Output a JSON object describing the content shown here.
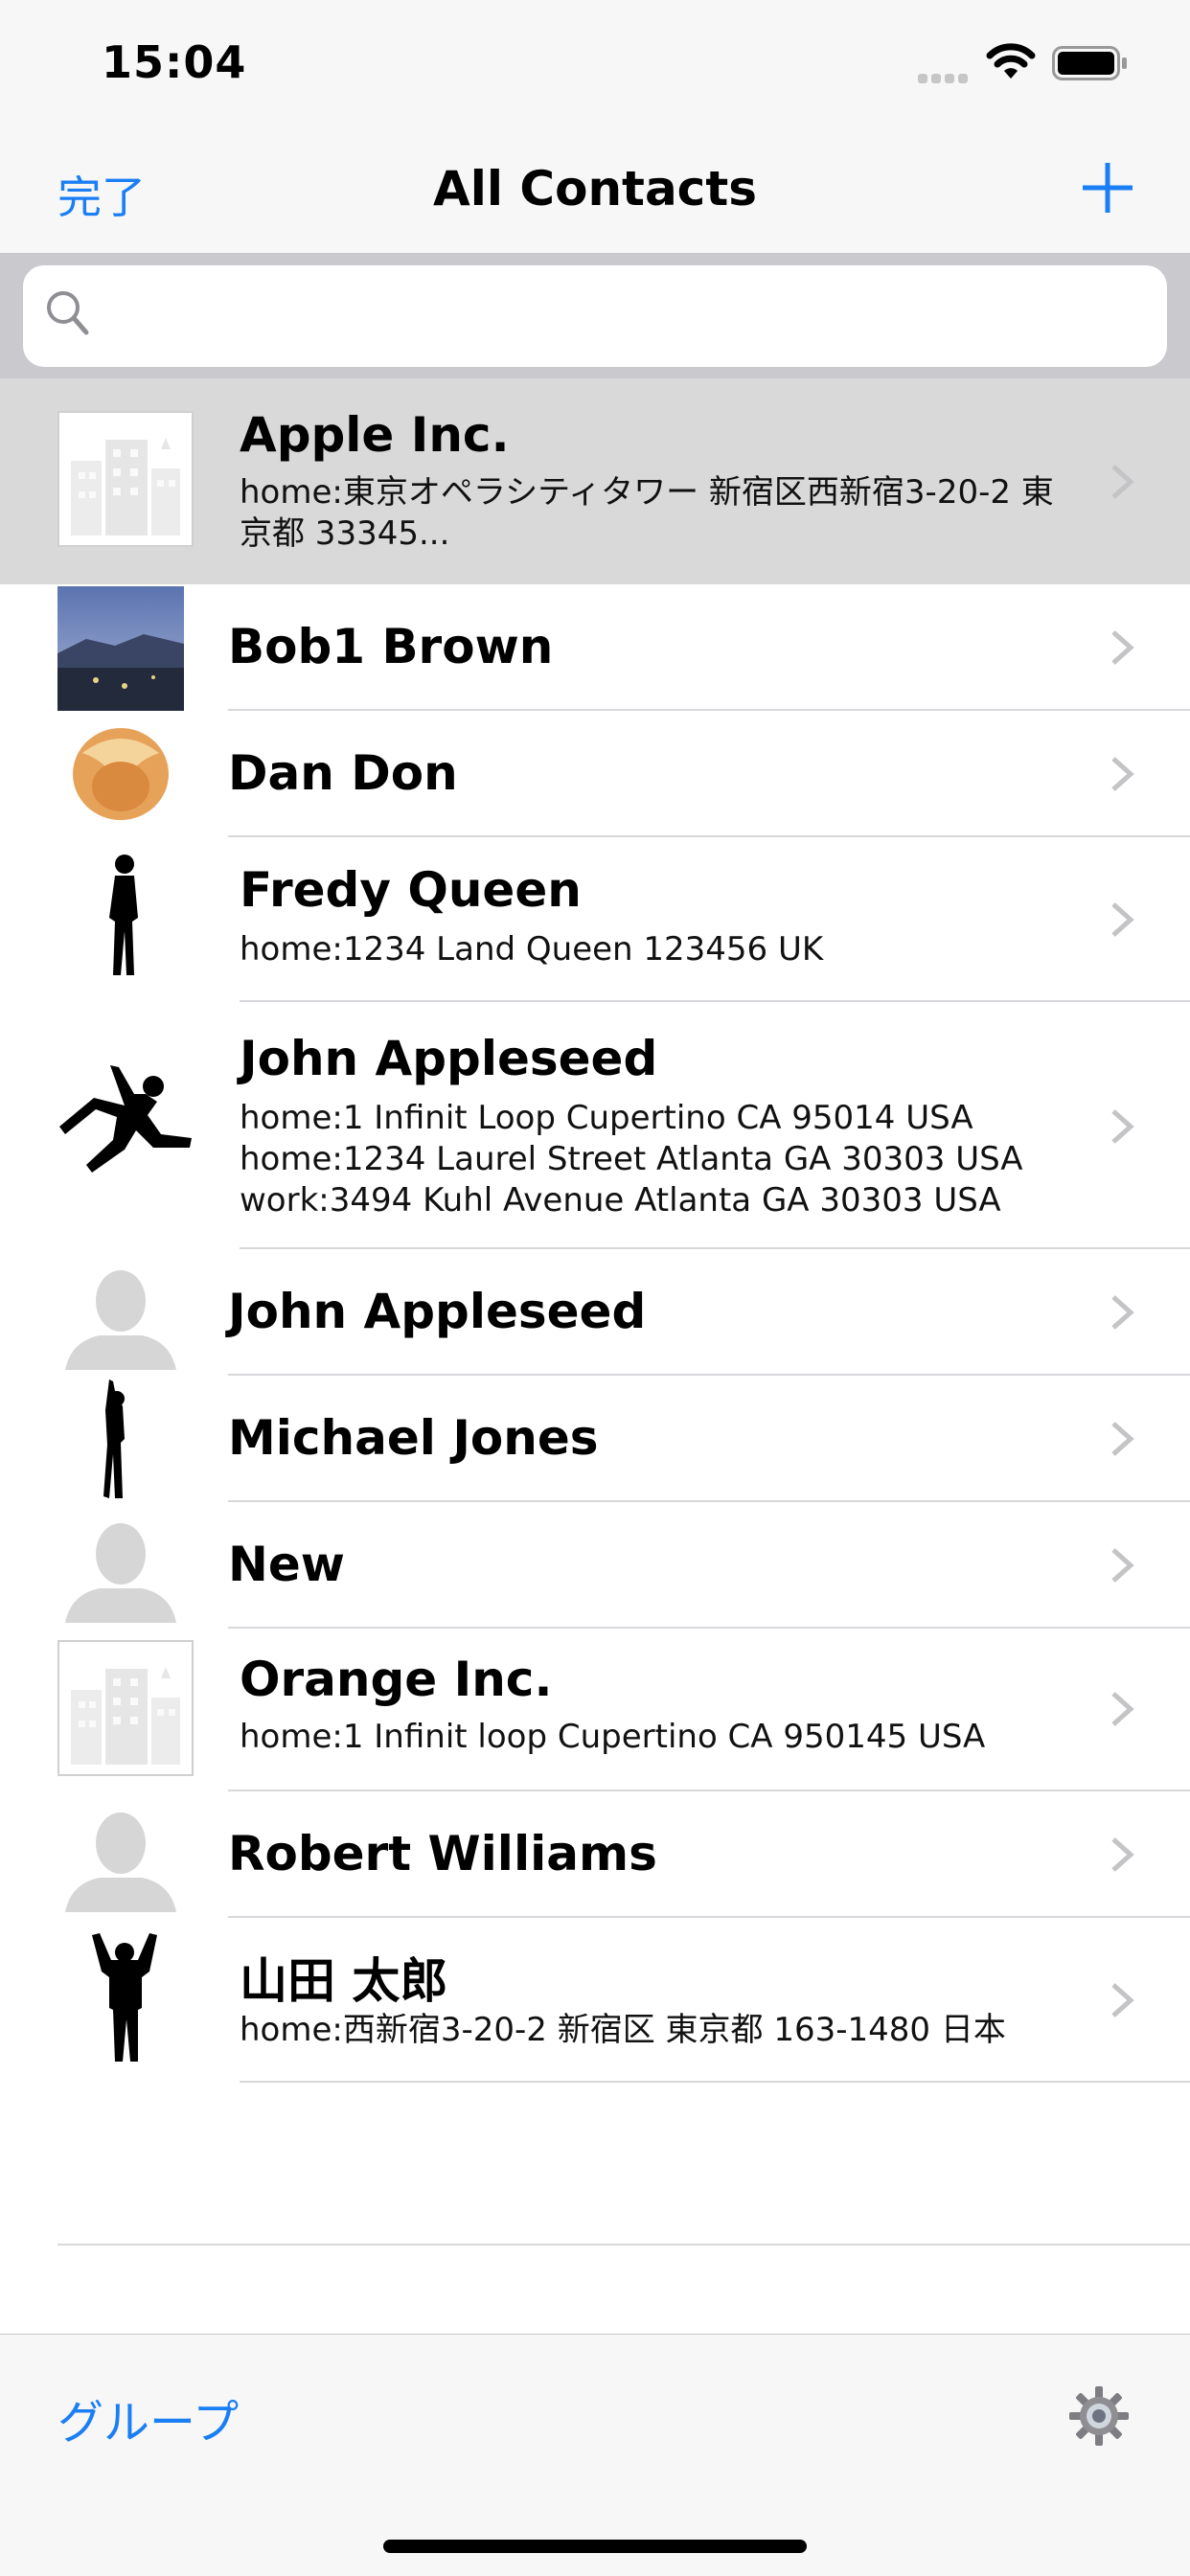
{
  "status": {
    "time": "15:04"
  },
  "nav": {
    "done": "完了",
    "title": "All Contacts",
    "add_icon": "plus-icon"
  },
  "search": {
    "placeholder": ""
  },
  "contacts": [
    {
      "name": "Apple Inc.",
      "address": "home:東京オペラシティタワー 新宿区西新宿3-20-2 東\n京都 33345...",
      "avatar": "building-icon"
    },
    {
      "name": "Bob1 Brown",
      "address": "",
      "avatar": "photo-landscape"
    },
    {
      "name": "Dan Don",
      "address": "",
      "avatar": "fortune-cookie"
    },
    {
      "name": "Fredy Queen",
      "address": "home:1234 Land Queen 123456 UK",
      "avatar": "silhouette-standing"
    },
    {
      "name": "John Appleseed",
      "address": "home:1 Infinit Loop Cupertino CA 95014 USA\nhome:1234 Laurel Street Atlanta GA 30303 USA\nwork:3494 Kuhl Avenue Atlanta GA 30303 USA",
      "avatar": "silhouette-jumping"
    },
    {
      "name": "John Appleseed",
      "address": "",
      "avatar": "default-person"
    },
    {
      "name": "Michael Jones",
      "address": "",
      "avatar": "silhouette-waving"
    },
    {
      "name": "New",
      "address": "",
      "avatar": "default-person"
    },
    {
      "name": "Orange Inc.",
      "address": "home:1 Infinit loop Cupertino CA 950145 USA",
      "avatar": "building-icon"
    },
    {
      "name": "Robert Williams",
      "address": "",
      "avatar": "default-person"
    },
    {
      "name": "山田 太郎",
      "address": "home:西新宿3-20-2 新宿区 東京都 163-1480 日本",
      "avatar": "silhouette-arms-up"
    }
  ],
  "toolbar": {
    "groups": "グループ",
    "settings_icon": "gear-icon"
  },
  "colors": {
    "accent": "#1a7ef5",
    "selected_row": "#d9d9d9"
  }
}
